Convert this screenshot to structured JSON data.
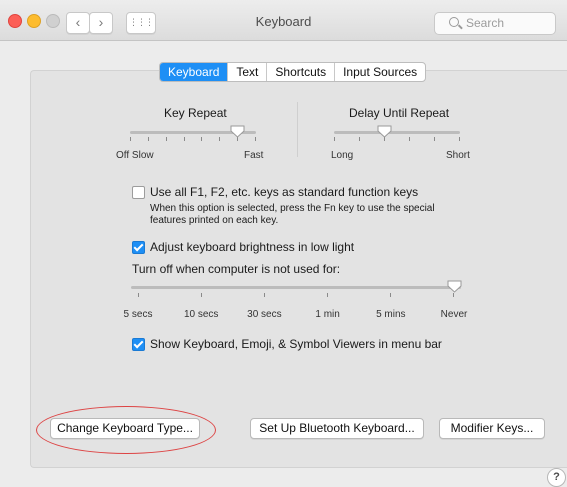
{
  "window": {
    "title": "Keyboard",
    "search_placeholder": "Search",
    "back_glyph": "‹",
    "forward_glyph": "›",
    "grid_glyph": "⋮⋮⋮"
  },
  "tabs": [
    {
      "label": "Keyboard",
      "active": true
    },
    {
      "label": "Text",
      "active": false
    },
    {
      "label": "Shortcuts",
      "active": false
    },
    {
      "label": "Input Sources",
      "active": false
    }
  ],
  "key_repeat": {
    "title": "Key Repeat",
    "min_label": "Off Slow",
    "max_label": "Fast",
    "level": 0.85
  },
  "delay_until_repeat": {
    "title": "Delay Until Repeat",
    "min_label": "Long",
    "max_label": "Short",
    "level": 0.4
  },
  "options": {
    "function_keys": {
      "label": "Use all F1, F2, etc. keys as standard function keys",
      "note_line1": "When this option is selected, press the Fn key to use the special",
      "note_line2": "features printed on each key.",
      "checked": false
    },
    "brightness": {
      "label": "Adjust keyboard brightness in low light",
      "checked": true
    },
    "viewers": {
      "label": "Show Keyboard, Emoji, & Symbol Viewers in menu bar",
      "checked": true
    }
  },
  "backlight": {
    "title": "Turn off when computer is not used for:",
    "stops": [
      "5 secs",
      "10 secs",
      "30 secs",
      "1 min",
      "5 mins",
      "Never"
    ],
    "selected": "Never"
  },
  "buttons": {
    "change_type": "Change Keyboard Type...",
    "bluetooth": "Set Up Bluetooth Keyboard...",
    "modifier": "Modifier Keys..."
  },
  "help_glyph": "?",
  "colors": {
    "accent": "#1e8ff5",
    "highlight_ellipse": "#dd4444"
  }
}
